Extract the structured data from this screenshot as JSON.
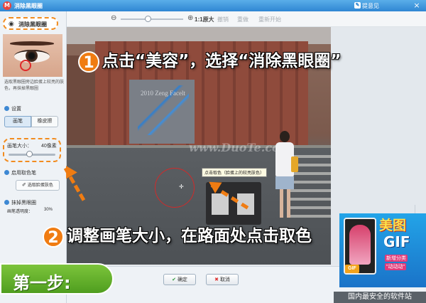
{
  "window": {
    "title": "消除黑眼圈",
    "hint": "提意见",
    "icon": "app-logo-icon",
    "close": "×"
  },
  "toolbar": {
    "zoom_out": "⊖",
    "zoom_in": "⊕",
    "original": "1:1原大",
    "undo": "撤销",
    "redo": "重做",
    "reset": "重新开始"
  },
  "left_panel": {
    "header_label": "消除黑眼圈",
    "description": "选取黑眼圈旁边脸蛋上较亮的肤色，再抹掉黑眼圈",
    "settings_title": "设置",
    "modes": [
      "画笔",
      "橡皮擦"
    ],
    "brush_size_label": "画笔大小：",
    "brush_size_value": "40像素",
    "brush_size_fraction": 0.45,
    "pick_title": "启用取色笔",
    "pick_button": "选取脸蛋肤色",
    "remove_title": "抹掉黑眼圈",
    "opacity_label": "画笔透明度：",
    "opacity_value": "30%"
  },
  "canvas": {
    "poster_text": "2010 Zeng Facelt",
    "watermark": "www.DuoTe.com",
    "tooltip": "点击取色（脸蛋上的较亮肤色）"
  },
  "buttons": {
    "ok": "确定",
    "cancel": "取消"
  },
  "callouts": {
    "num1": "1",
    "text1": "点击“美容”，选择“消除黑眼圈”",
    "num2": "2",
    "text2": "调整画笔大小，在路面处点击取色"
  },
  "step_badge": "第一步:",
  "ad": {
    "title": "美图",
    "gif": "GIF",
    "line1": "新增分类",
    "line2": "\"动动动\"",
    "tag": "GIF"
  },
  "site_tag": "国内最安全的软件站",
  "colors": {
    "accent": "#f07c12",
    "title_bar": "#2f86d3",
    "step_green": "#5aab26"
  }
}
